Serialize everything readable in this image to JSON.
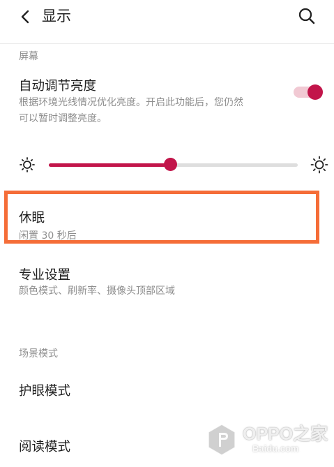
{
  "header": {
    "title": "显示",
    "back_icon": "chevron-left-icon",
    "search_icon": "search-icon"
  },
  "screen_section": {
    "header": "屏幕",
    "auto_brightness": {
      "title": "自动调节亮度",
      "description_line1": "根据环境光线情况优化亮度。开启此功能后，您仍然",
      "description_line2": "可以暂时调整亮度。",
      "enabled": true
    },
    "brightness_slider": {
      "level": 0.49,
      "min_icon": "sun-small-icon",
      "max_icon": "sun-large-icon"
    },
    "sleep": {
      "title": "休眠",
      "subtitle": "闲置 30 秒后",
      "highlighted": true
    },
    "pro_settings": {
      "title": "专业设置",
      "subtitle": "颜色模式、刷新率、摄像头顶部区域"
    }
  },
  "scene_section": {
    "header": "场景模式",
    "eye_comfort": {
      "title": "护眼模式"
    },
    "reading_mode": {
      "title": "阅读模式"
    }
  },
  "colors": {
    "accent": "#c2154a",
    "accent_light": "#f1c9d3",
    "highlight": "#f56d38"
  },
  "watermark": {
    "brand": "OPPO之家",
    "domain": "Baidu.com"
  }
}
